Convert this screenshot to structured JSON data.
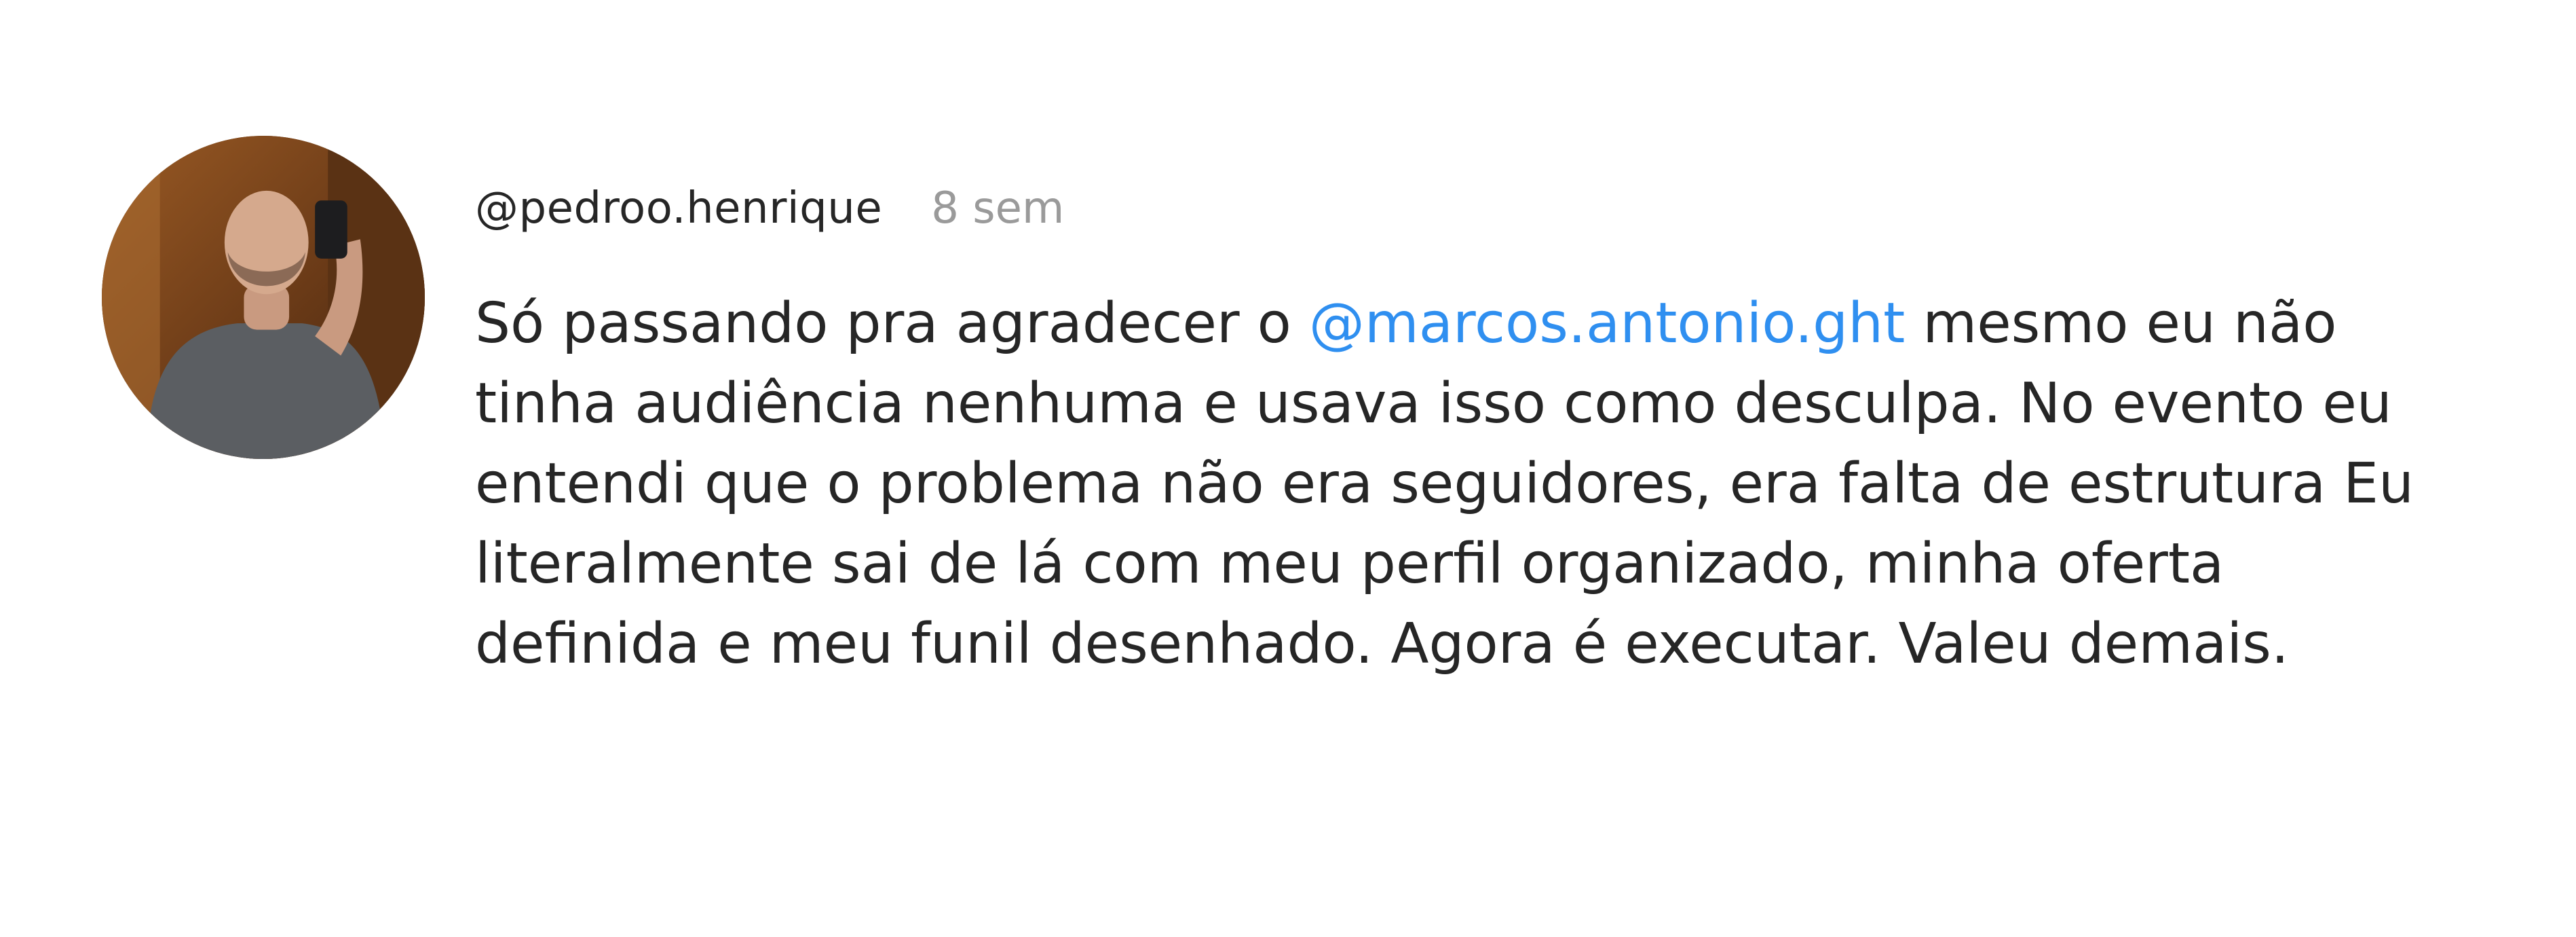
{
  "comment": {
    "username": "@pedroo.henrique",
    "timestamp": "8 sem",
    "text_before_mention": "Só passando pra agradecer o ",
    "mention": "@marcos.antonio.ght",
    "text_after_mention": " mesmo eu não tinha audiência nenhuma e usava isso como desculpa. No evento eu entendi que o problema não era seguidores, era falta de estrutura Eu literalmente sai de lá com meu perfil organizado, minha oferta definida e meu funil desenhado. Agora é executar. Valeu demais.",
    "mention_color": "#2f8ff0",
    "avatar_icon": "user-photo-avatar"
  }
}
